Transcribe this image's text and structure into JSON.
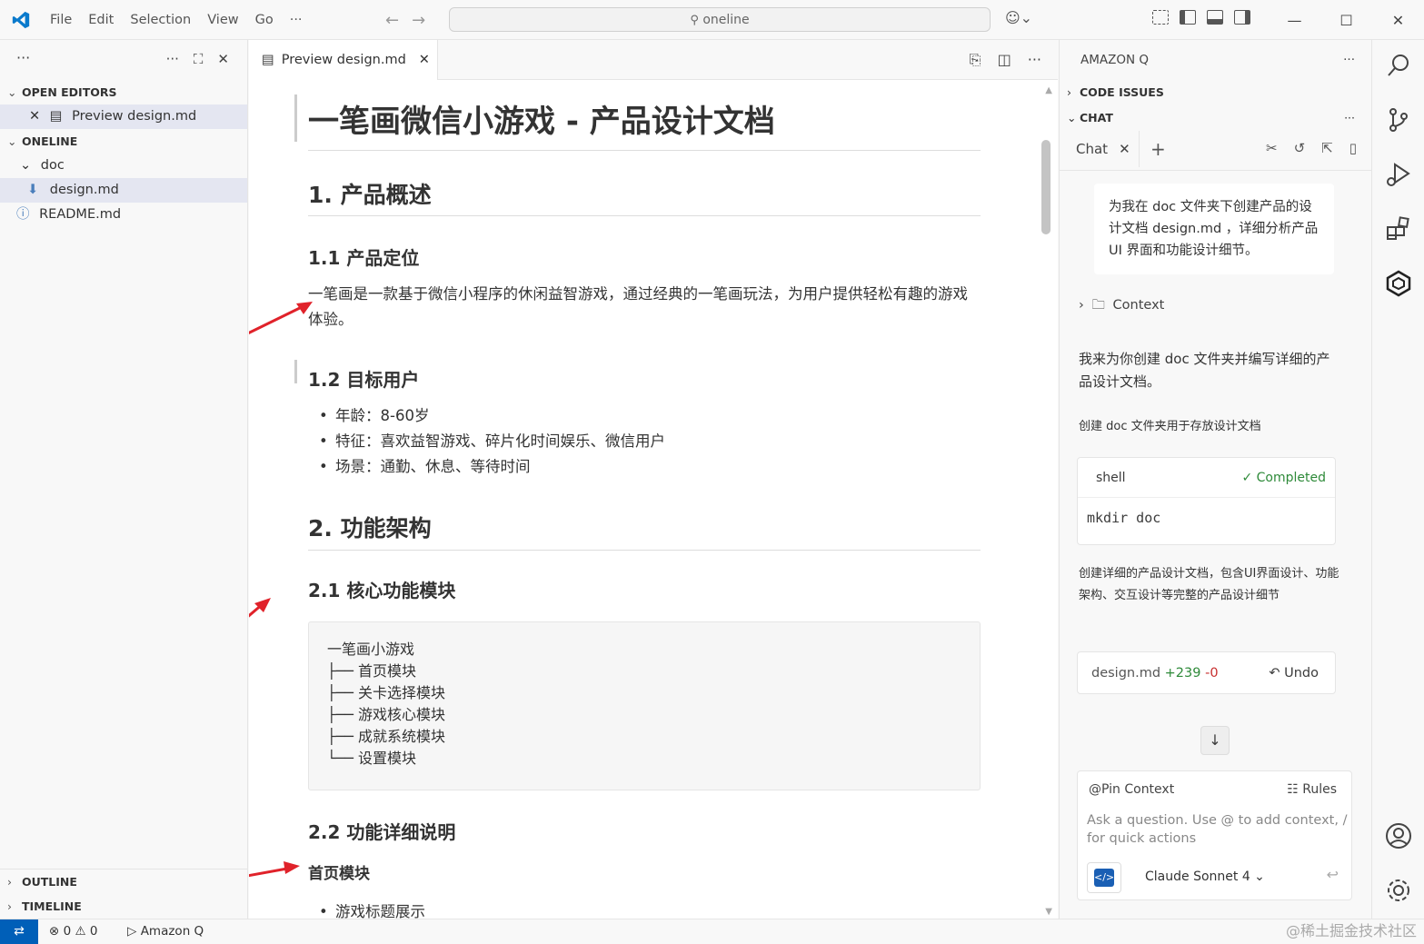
{
  "menu": [
    "File",
    "Edit",
    "Selection",
    "View",
    "Go",
    "···"
  ],
  "search_text": "oneline",
  "sidebar": {
    "open_editors_title": "OPEN EDITORS",
    "open_editor_item": "Preview design.md",
    "project_title": "ONELINE",
    "folder": "doc",
    "file_design": "design.md",
    "file_readme": "README.md",
    "outline": "OUTLINE",
    "timeline": "TIMELINE"
  },
  "editor": {
    "tab_label": "Preview design.md",
    "h1": "一笔画微信小游戏 - 产品设计文档",
    "s1": "1. 产品概述",
    "s11": "1.1 产品定位",
    "s11_text": "一笔画是一款基于微信小程序的休闲益智游戏，通过经典的一笔画玩法，为用户提供轻松有趣的游戏体验。",
    "s12": "1.2 目标用户",
    "s12_items": [
      "年龄：8-60岁",
      "特征：喜欢益智游戏、碎片化时间娱乐、微信用户",
      "场景：通勤、休息、等待时间"
    ],
    "s2": "2. 功能架构",
    "s21": "2.1 核心功能模块",
    "tree": [
      "一笔画小游戏",
      "├── 首页模块",
      "├── 关卡选择模块",
      "├── 游戏核心模块",
      "├── 成就系统模块",
      "└── 设置模块"
    ],
    "s22": "2.2 功能详细说明",
    "s22_sub": "首页模块",
    "s22_item": "游戏标题展示"
  },
  "amazonq": {
    "header": "AMAZON Q",
    "code_issues": "CODE ISSUES",
    "chat_section": "CHAT",
    "chat_tab": "Chat",
    "user_prompt": "为我在 doc 文件夹下创建产品的设计文档 design.md ，详细分析产品 UI 界面和功能设计细节。",
    "context_label": "Context",
    "reply1": "我来为你创建 doc 文件夹并编写详细的产品设计文档。",
    "reply2": "创建 doc 文件夹用于存放设计文档",
    "shell_label": "shell",
    "shell_status": "Completed",
    "shell_cmd": "mkdir doc",
    "reply3": "创建详细的产品设计文档，包含UI界面设计、功能架构、交互设计等完整的产品设计细节",
    "diff_file": "design.md",
    "diff_add": "+239",
    "diff_del": "-0",
    "undo_label": "Undo",
    "pin_context": "@Pin Context",
    "rules_label": "Rules",
    "input_placeholder": "Ask a question. Use @ to add context, / for quick actions",
    "model_label": "Claude Sonnet 4"
  },
  "status": {
    "errors": "0",
    "warnings": "0",
    "amazonq": "Amazon Q",
    "watermark": "@稀土掘金技术社区"
  },
  "colors": {
    "accent": "#005fb8",
    "added": "#2e8a39",
    "removed": "#c72e2e",
    "arrow": "#e0222a",
    "completed": "#2e8a39"
  }
}
